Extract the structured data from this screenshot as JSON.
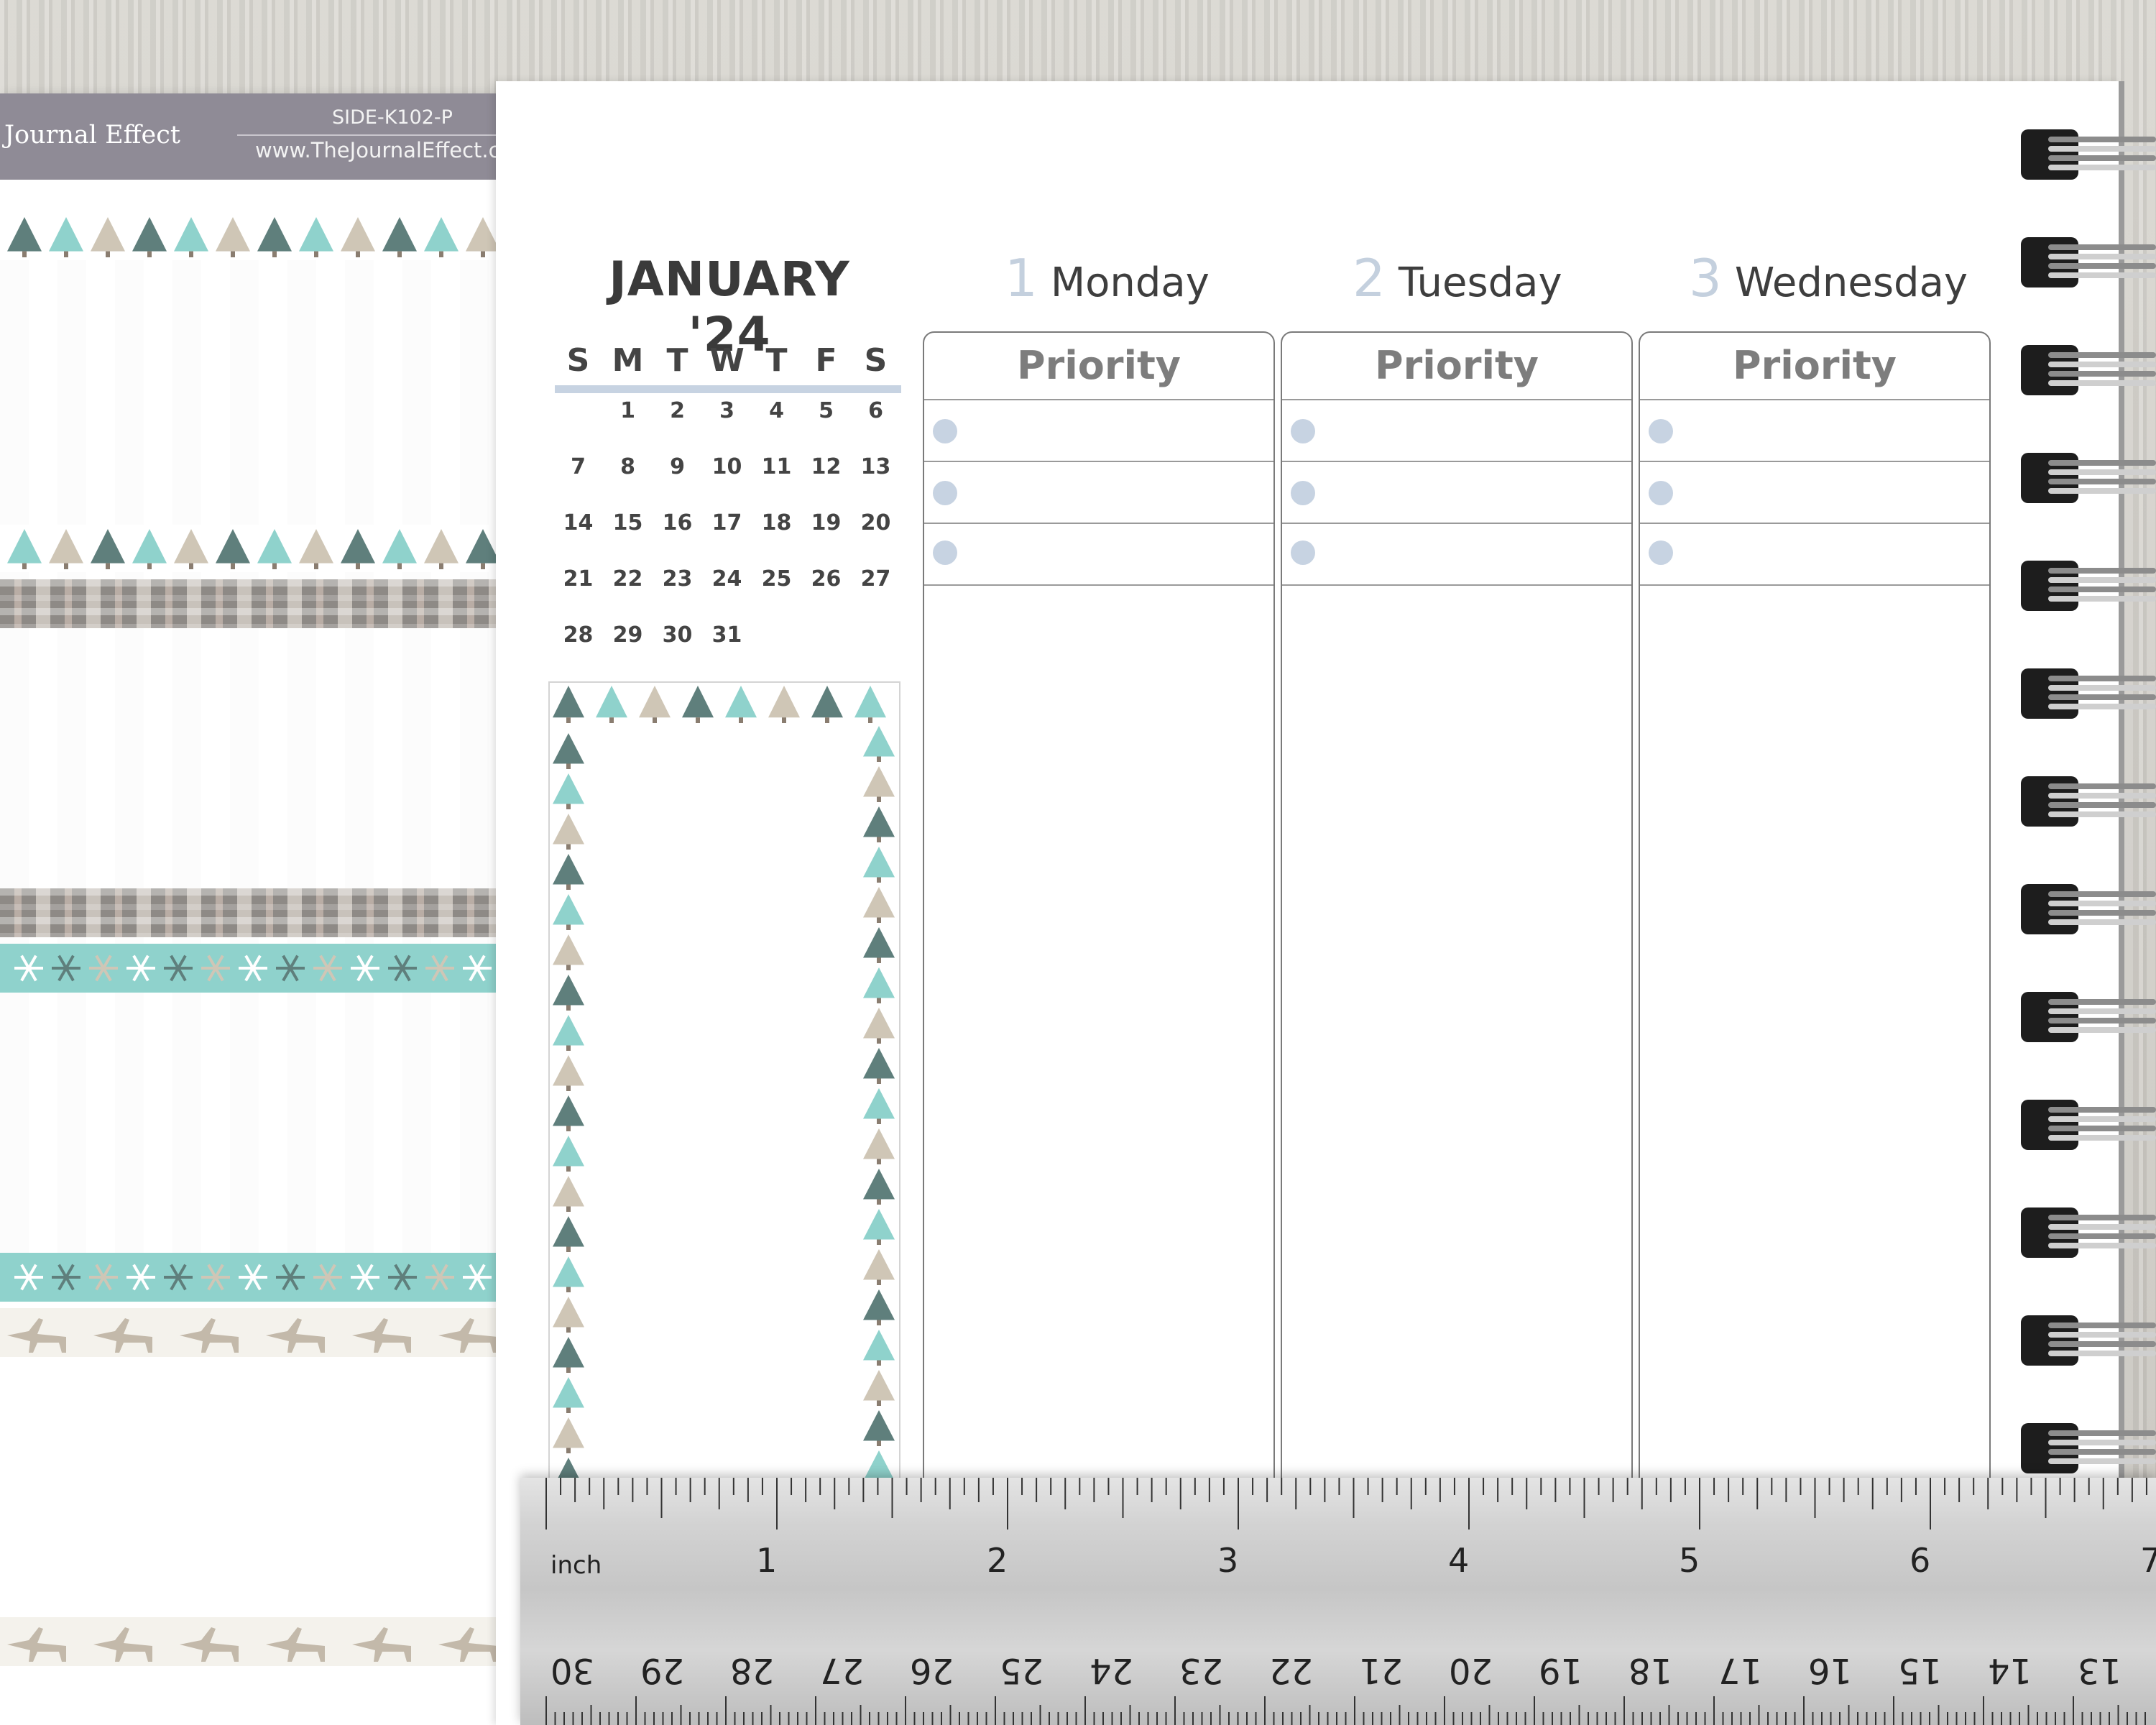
{
  "sticker_sheet": {
    "brand": "Journal Effect",
    "sku": "SIDE-K102-P",
    "website": "www.TheJournalEffect.c",
    "colors": {
      "header": "#8f8b96",
      "teal": "#8fd2cc",
      "plaid": "#8e8a86",
      "beige": "#f4f2ec"
    }
  },
  "mini_calendar": {
    "title": "JANUARY '24",
    "weekdays": [
      "S",
      "M",
      "T",
      "W",
      "T",
      "F",
      "S"
    ],
    "weeks": [
      [
        "",
        "1",
        "2",
        "3",
        "4",
        "5",
        "6"
      ],
      [
        "7",
        "8",
        "9",
        "10",
        "11",
        "12",
        "13"
      ],
      [
        "14",
        "15",
        "16",
        "17",
        "18",
        "19",
        "20"
      ],
      [
        "21",
        "22",
        "23",
        "24",
        "25",
        "26",
        "27"
      ],
      [
        "28",
        "29",
        "30",
        "31",
        "",
        "",
        ""
      ]
    ]
  },
  "days": [
    {
      "num": "1",
      "name": "Monday",
      "section": "Priority"
    },
    {
      "num": "2",
      "name": "Tuesday",
      "section": "Priority"
    },
    {
      "num": "3",
      "name": "Wednesday",
      "section": "Priority"
    }
  ],
  "ruler": {
    "unit_label": "inch",
    "inch_numbers": [
      "1",
      "2",
      "3",
      "4",
      "5",
      "6",
      "7"
    ],
    "cm_numbers": [
      "30",
      "29",
      "28",
      "27",
      "26",
      "25",
      "24",
      "23",
      "22",
      "21",
      "20",
      "19",
      "18",
      "17",
      "16",
      "15",
      "14",
      "13"
    ]
  }
}
